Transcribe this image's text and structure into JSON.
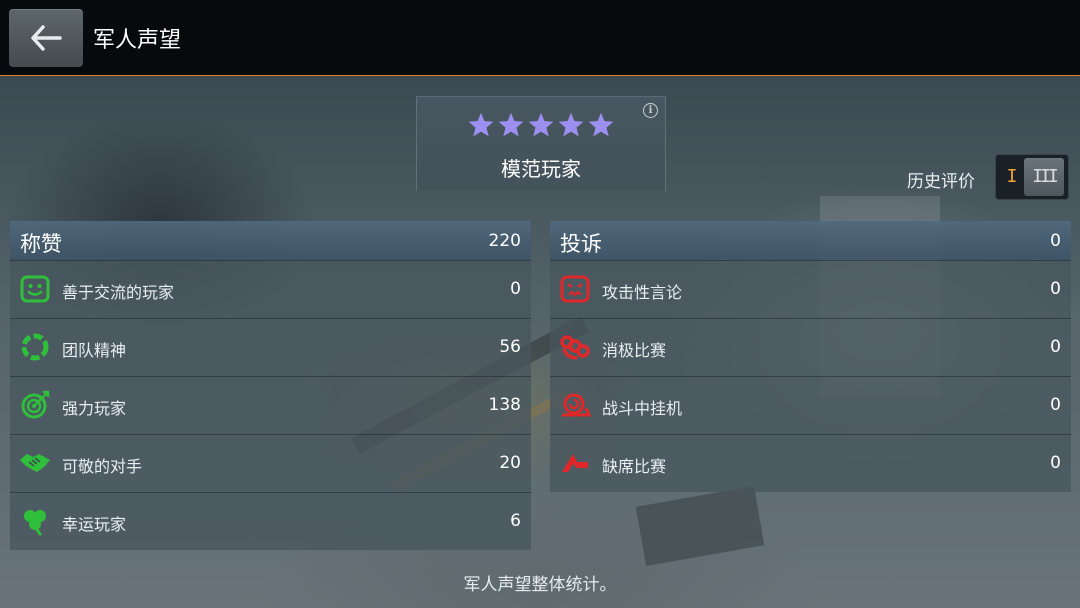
{
  "header": {
    "title": "军人声望",
    "back_icon": "arrow-left-icon"
  },
  "rating": {
    "stars": 5,
    "star_color": "#9d8ff0",
    "label": "模范玩家"
  },
  "history": {
    "label": "历史评价",
    "option_one": "I",
    "option_three": "III",
    "selected": "III"
  },
  "praise": {
    "title": "称赞",
    "count": "220",
    "accent": "#2fbf3a",
    "items": [
      {
        "icon": "smile-icon",
        "label": "善于交流的玩家",
        "value": "0"
      },
      {
        "icon": "team-circle-icon",
        "label": "团队精神",
        "value": "56"
      },
      {
        "icon": "target-icon",
        "label": "强力玩家",
        "value": "138"
      },
      {
        "icon": "handshake-icon",
        "label": "可敬的对手",
        "value": "20"
      },
      {
        "icon": "clover-icon",
        "label": "幸运玩家",
        "value": "6"
      }
    ]
  },
  "complaints": {
    "title": "投诉",
    "count": "0",
    "accent": "#e0282a",
    "items": [
      {
        "icon": "angry-face-icon",
        "label": "攻击性言论",
        "value": "0"
      },
      {
        "icon": "brass-knuckles-icon",
        "label": "消极比赛",
        "value": "0"
      },
      {
        "icon": "snail-icon",
        "label": "战斗中挂机",
        "value": "0"
      },
      {
        "icon": "exit-icon",
        "label": "缺席比赛",
        "value": "0"
      }
    ]
  },
  "footer": {
    "text": "军人声望整体统计。"
  }
}
